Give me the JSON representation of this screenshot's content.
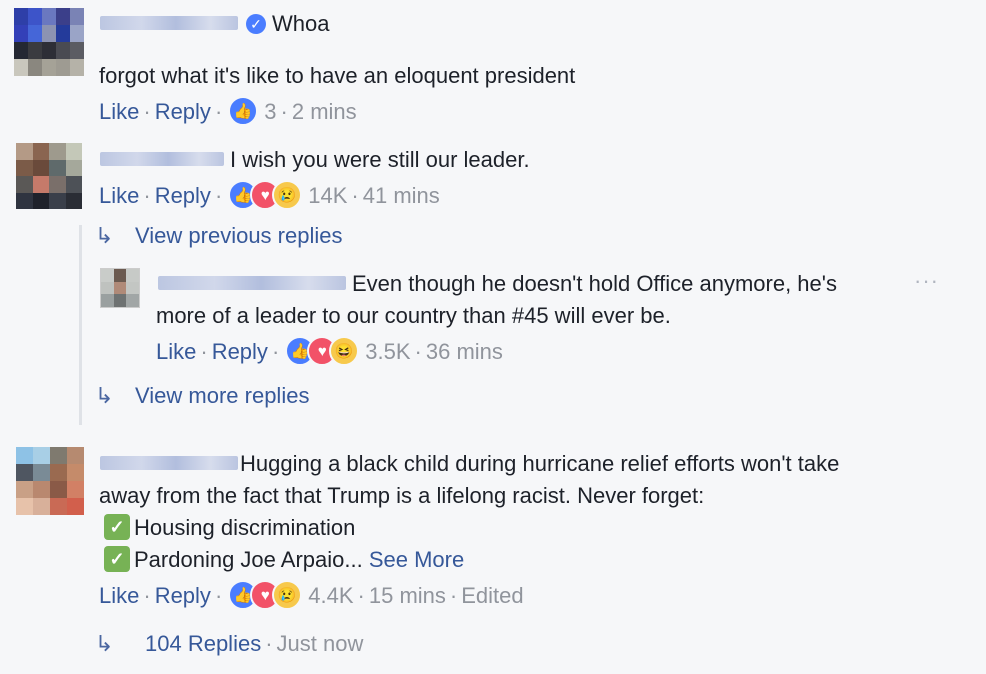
{
  "comments": [
    {
      "text_line1": "Whoa",
      "text_line2": "forgot what it's like to have an eloquent president",
      "like": "Like",
      "reply": "Reply",
      "reaction_count": "3",
      "time": "2 mins"
    },
    {
      "text": "I wish you were still our leader.",
      "like": "Like",
      "reply": "Reply",
      "reaction_count": "14K",
      "time": "41 mins",
      "view_previous": "View previous replies",
      "view_more": "View more replies",
      "nested": {
        "text_line1": "Even though he doesn't hold Office anymore, he's",
        "text_line2": "more of a leader to our country than #45 will ever be.",
        "more_icon": "···",
        "like": "Like",
        "reply": "Reply",
        "reaction_count": "3.5K",
        "time": "36 mins"
      }
    },
    {
      "text_line1": "Hugging a black child during hurricane relief efforts won't take",
      "text_line2": "away from the fact that Trump is a lifelong racist. Never forget:",
      "item1": "Housing discrimination",
      "item2": "Pardoning Joe Arpaio...",
      "see_more": "See More",
      "like": "Like",
      "reply": "Reply",
      "reaction_count": "4.4K",
      "time": "15 mins",
      "edited": "Edited",
      "replies_count": "104 Replies",
      "replies_time": "Just now"
    }
  ],
  "separator": "·",
  "icons": {
    "reply_arrow": "↳",
    "check": "✓",
    "verified": "✓",
    "like": "👍",
    "love": "♥"
  },
  "colors": {
    "link": "#365899",
    "meta": "#90949c",
    "background": "#f6f7f9",
    "like_blue": "#4a7dff",
    "love_red": "#f25268",
    "check_green": "#77b255"
  }
}
